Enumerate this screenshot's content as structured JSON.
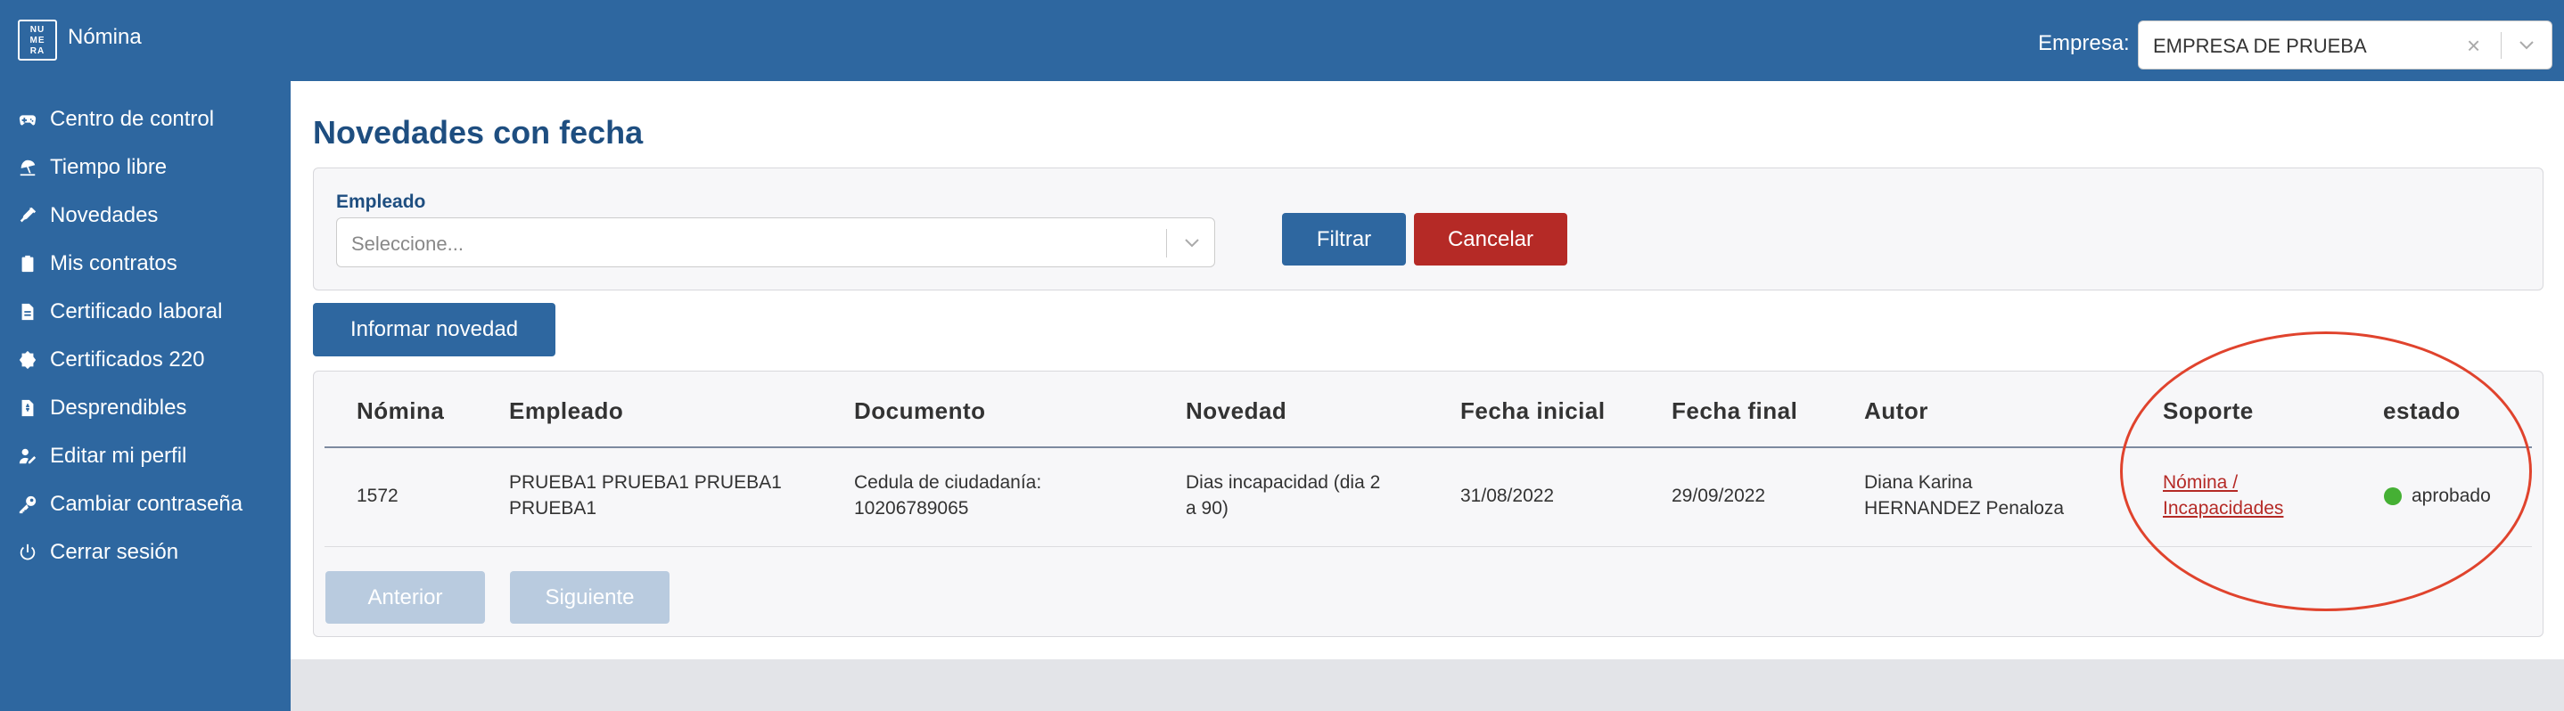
{
  "header": {
    "logo_text": "NU ME RA",
    "app_title": "Nómina",
    "company_label": "Empresa:",
    "company_value": "EMPRESA DE PRUEBA"
  },
  "sidebar": {
    "items": [
      {
        "label": "Centro de control",
        "icon": "gamepad-icon"
      },
      {
        "label": "Tiempo libre",
        "icon": "beach-icon"
      },
      {
        "label": "Novedades",
        "icon": "syringe-icon"
      },
      {
        "label": "Mis contratos",
        "icon": "clipboard-icon"
      },
      {
        "label": "Certificado laboral",
        "icon": "file-icon"
      },
      {
        "label": "Certificados 220",
        "icon": "certificate-icon"
      },
      {
        "label": "Desprendibles",
        "icon": "invoice-icon"
      },
      {
        "label": "Editar mi perfil",
        "icon": "user-edit-icon"
      },
      {
        "label": "Cambiar contraseña",
        "icon": "key-icon"
      },
      {
        "label": "Cerrar sesión",
        "icon": "power-icon"
      }
    ]
  },
  "main": {
    "title": "Novedades con fecha",
    "filter": {
      "label": "Empleado",
      "placeholder": "Seleccione...",
      "filter_button": "Filtrar",
      "cancel_button": "Cancelar"
    },
    "report_button": "Informar novedad",
    "table": {
      "headers": [
        "Nómina",
        "Empleado",
        "Documento",
        "Novedad",
        "Fecha inicial",
        "Fecha final",
        "Autor",
        "Soporte",
        "estado"
      ],
      "rows": [
        {
          "nomina": "1572",
          "empleado_1": "PRUEBA1 PRUEBA1 PRUEBA1",
          "empleado_2": "PRUEBA1",
          "documento_1": "Cedula de ciudadanía:",
          "documento_2": "10206789065",
          "novedad_1": "Dias incapacidad (dia 2",
          "novedad_2": "a 90)",
          "fecha_inicial": "31/08/2022",
          "fecha_final": "29/09/2022",
          "autor_1": "Diana Karina",
          "autor_2": "HERNANDEZ Penaloza",
          "soporte_1": "Nómina /",
          "soporte_2": "Incapacidades",
          "estado": "aprobado",
          "estado_color": "#45b034"
        }
      ]
    },
    "pagination": {
      "prev": "Anterior",
      "next": "Siguiente"
    }
  },
  "colors": {
    "brand": "#2e67a0",
    "danger": "#b52a26",
    "annotation": "#e0432d"
  }
}
